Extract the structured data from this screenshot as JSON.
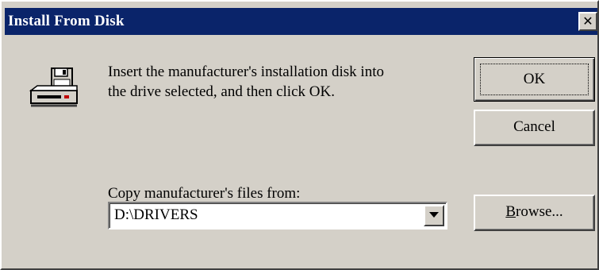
{
  "window": {
    "title": "Install From Disk",
    "close_glyph": "✕"
  },
  "message": {
    "line1": "Insert the manufacturer's installation disk into",
    "line2": "the drive selected, and then click OK."
  },
  "buttons": {
    "ok": "OK",
    "cancel": "Cancel",
    "browse_mnemonic": "B",
    "browse_rest": "rowse..."
  },
  "copy_from": {
    "label": "Copy manufacturer's files from:",
    "value": "D:\\DRIVERS"
  },
  "icons": {
    "disk": "floppy-drive-icon",
    "dropdown": "dropdown-arrow-icon"
  },
  "colors": {
    "titlebar": "#0a246a",
    "face": "#d4d0c8"
  }
}
